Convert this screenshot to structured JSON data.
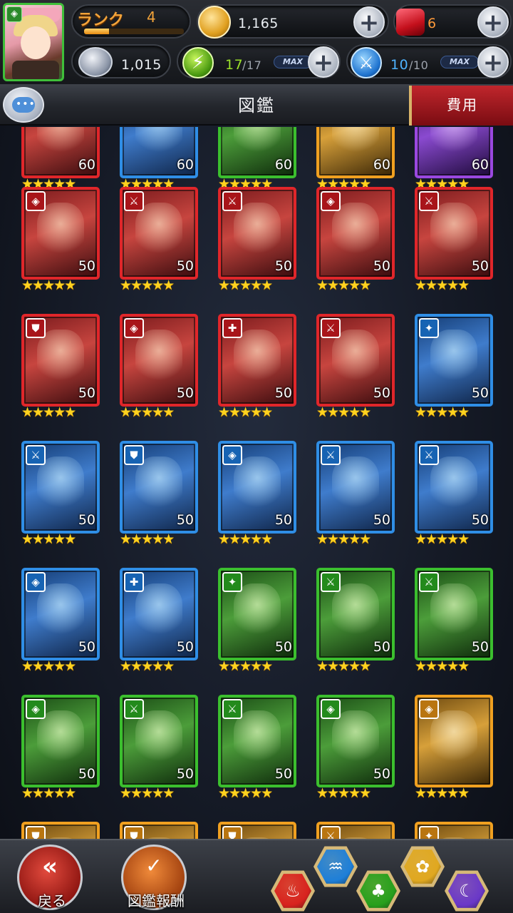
{
  "status": {
    "rank_label": "ランク",
    "rank_value": "4",
    "rank_progress": 0.25,
    "gold": "1,165",
    "gems": "6",
    "friend_points": "1,015",
    "stamina_current": "17",
    "stamina_max": "/17",
    "stamina_max_tag": "MAX",
    "battle_current": "10",
    "battle_max": "/10",
    "battle_max_tag": "MAX"
  },
  "titlebar": {
    "title": "図鑑",
    "cost_tab": "費用"
  },
  "colors": {
    "red": "#e0262a",
    "blue": "#2f8ee6",
    "green": "#3bbf2e",
    "gold": "#f0a020",
    "rank_text": "#f2a33a",
    "stamina_text": "#9be02a",
    "battle_text": "#4fb3ff"
  },
  "grid": {
    "rows": [
      {
        "cards": [
          {
            "frame": "red",
            "level": "60",
            "icon": "sword-icon"
          },
          {
            "frame": "blue",
            "level": "60",
            "icon": "sword-icon"
          },
          {
            "frame": "green",
            "level": "60",
            "icon": "sword-icon"
          },
          {
            "frame": "gold",
            "level": "60",
            "icon": "sword-icon"
          },
          {
            "frame": "purple",
            "level": "60",
            "icon": "sword-icon"
          }
        ]
      },
      {
        "cards": [
          {
            "frame": "red",
            "level": "50",
            "icon": "magic-icon"
          },
          {
            "frame": "red",
            "level": "50",
            "icon": "sword-icon"
          },
          {
            "frame": "red",
            "level": "50",
            "icon": "sword-icon"
          },
          {
            "frame": "red",
            "level": "50",
            "icon": "magic-icon"
          },
          {
            "frame": "red",
            "level": "50",
            "icon": "sword-icon"
          }
        ]
      },
      {
        "cards": [
          {
            "frame": "red",
            "level": "50",
            "icon": "shield-icon"
          },
          {
            "frame": "red",
            "level": "50",
            "icon": "magic-icon"
          },
          {
            "frame": "red",
            "level": "50",
            "icon": "heal-icon"
          },
          {
            "frame": "red",
            "level": "50",
            "icon": "sword-icon"
          },
          {
            "frame": "blue",
            "level": "50",
            "icon": "support-icon"
          }
        ]
      },
      {
        "cards": [
          {
            "frame": "blue",
            "level": "50",
            "icon": "sword-icon"
          },
          {
            "frame": "blue",
            "level": "50",
            "icon": "shield-icon"
          },
          {
            "frame": "blue",
            "level": "50",
            "icon": "magic-icon"
          },
          {
            "frame": "blue",
            "level": "50",
            "icon": "sword-icon"
          },
          {
            "frame": "blue",
            "level": "50",
            "icon": "sword-icon"
          }
        ]
      },
      {
        "cards": [
          {
            "frame": "blue",
            "level": "50",
            "icon": "magic-icon"
          },
          {
            "frame": "blue",
            "level": "50",
            "icon": "heal-icon"
          },
          {
            "frame": "green",
            "level": "50",
            "icon": "support-icon"
          },
          {
            "frame": "green",
            "level": "50",
            "icon": "sword-icon"
          },
          {
            "frame": "green",
            "level": "50",
            "icon": "sword-icon"
          }
        ]
      },
      {
        "cards": [
          {
            "frame": "green",
            "level": "50",
            "icon": "magic-icon"
          },
          {
            "frame": "green",
            "level": "50",
            "icon": "sword-icon"
          },
          {
            "frame": "green",
            "level": "50",
            "icon": "sword-icon"
          },
          {
            "frame": "green",
            "level": "50",
            "icon": "magic-icon"
          },
          {
            "frame": "gold",
            "level": "",
            "icon": "magic-icon"
          }
        ]
      },
      {
        "cards": [
          {
            "frame": "gold",
            "level": "",
            "icon": "shield-icon"
          },
          {
            "frame": "gold",
            "level": "",
            "icon": "shield-icon"
          },
          {
            "frame": "gold",
            "level": "",
            "icon": "shield-icon"
          },
          {
            "frame": "gold",
            "level": "",
            "icon": "sword-icon"
          },
          {
            "frame": "gold",
            "level": "",
            "icon": "support-icon"
          }
        ]
      }
    ]
  },
  "bottom": {
    "back_label": "戻る",
    "reward_label": "図鑑報酬",
    "element_filters": [
      {
        "name": "fire-element-filter",
        "color": "#d8231e",
        "glyph": "♨"
      },
      {
        "name": "water-element-filter",
        "color": "#1e7fd8",
        "glyph": "♒"
      },
      {
        "name": "wood-element-filter",
        "color": "#27a01c",
        "glyph": "♣"
      },
      {
        "name": "light-element-filter",
        "color": "#e0a820",
        "glyph": "✿"
      },
      {
        "name": "dark-element-filter",
        "color": "#6a38c8",
        "glyph": "☾"
      }
    ]
  }
}
